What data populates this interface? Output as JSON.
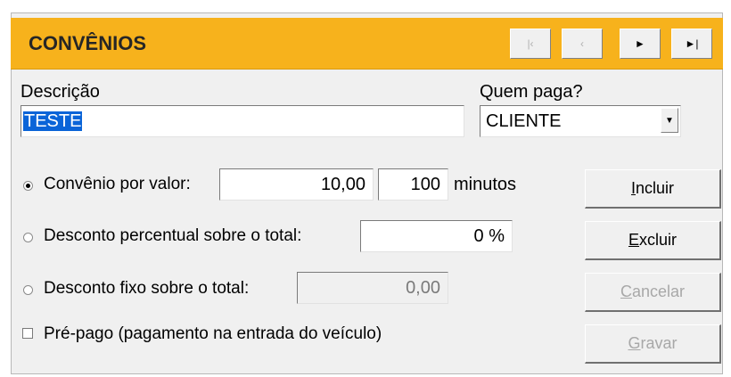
{
  "header": {
    "title": "CONVÊNIOS",
    "nav": [
      {
        "glyph": "|‹",
        "enabled": false
      },
      {
        "glyph": "‹",
        "enabled": false
      },
      {
        "glyph": "►",
        "enabled": true
      },
      {
        "glyph": "►|",
        "enabled": true
      }
    ],
    "bg_color": "#f7b21c"
  },
  "form": {
    "descricao_label": "Descrição",
    "descricao_value": "TESTE",
    "quem_paga_label": "Quem paga?",
    "quem_paga_value": "CLIENTE",
    "option_valor_label": "Convênio por valor:",
    "option_valor_selected": true,
    "valor_amount": "10,00",
    "valor_minutes": "100",
    "minutes_label": "minutos",
    "option_percentual_label": "Desconto percentual sobre o total:",
    "percentual_value": "0 %",
    "option_fixo_label": "Desconto fixo sobre o total:",
    "fixo_value": "0,00",
    "prepago_label": "Pré-pago (pagamento na entrada do veículo)",
    "prepago_checked": false
  },
  "buttons": {
    "incluir_first": "I",
    "incluir_rest": "ncluir",
    "excluir_first": "E",
    "excluir_rest": "xcluir",
    "cancelar_first": "C",
    "cancelar_rest": "ancelar",
    "gravar_first": "G",
    "gravar_rest": "ravar"
  }
}
